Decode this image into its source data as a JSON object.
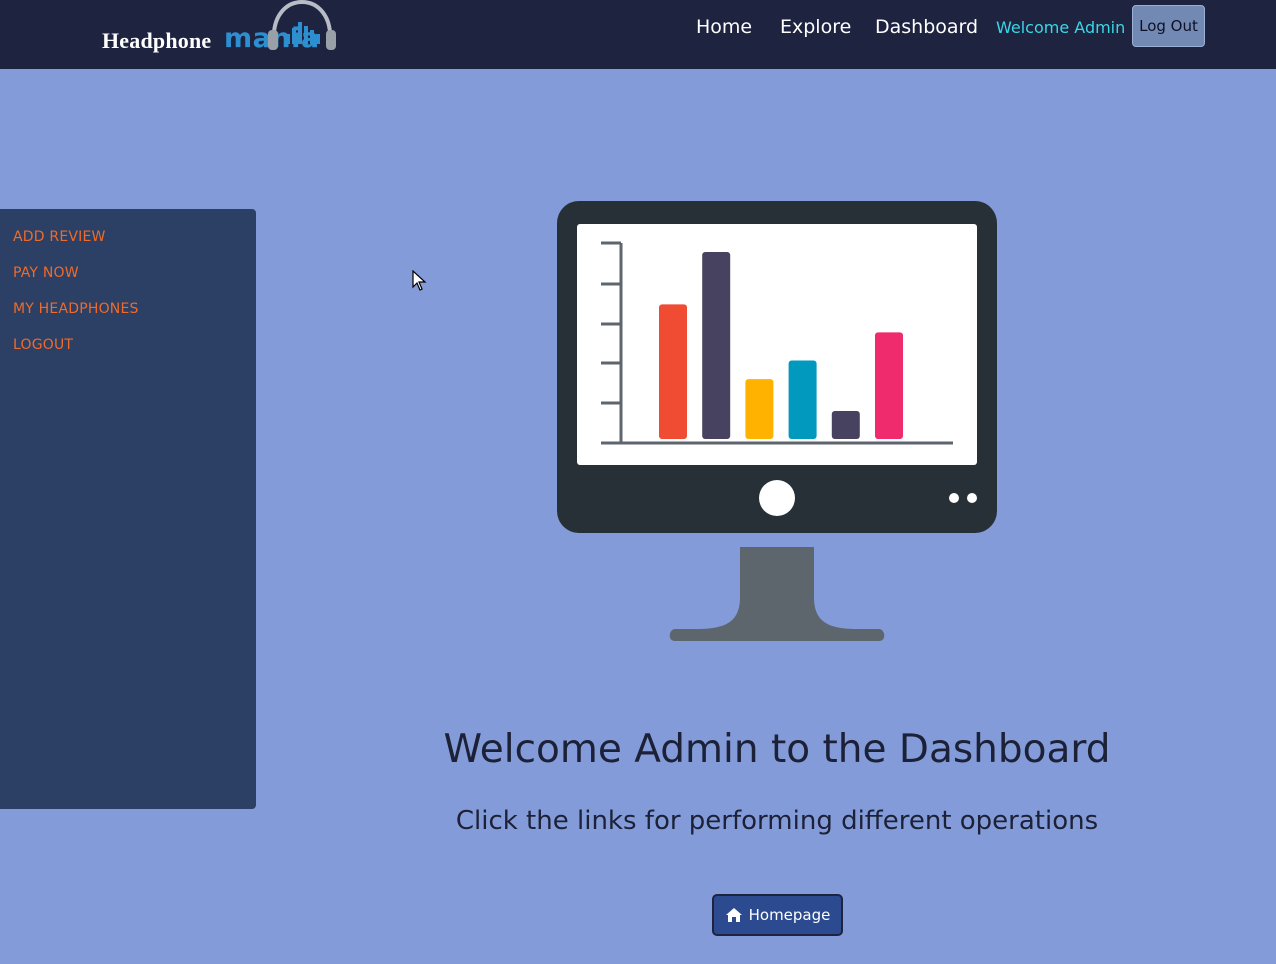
{
  "header": {
    "logo_part1": "Headphone",
    "logo_part2": "mania",
    "nav": [
      "Home",
      "Explore",
      "Dashboard"
    ],
    "welcome": "Welcome Admin",
    "logout_label": "Log Out"
  },
  "sidebar": {
    "items": [
      {
        "label": "ADD REVIEW"
      },
      {
        "label": "PAY NOW"
      },
      {
        "label": "MY HEADPHONES"
      },
      {
        "label": "LOGOUT"
      }
    ]
  },
  "main": {
    "title": "Welcome Admin to the Dashboard",
    "subtitle": "Click the links for performing different operations",
    "home_button_label": "Homepage",
    "home_button_icon": "home-icon"
  },
  "illustration": {
    "bar_levels": [
      0.72,
      1.0,
      0.32,
      0.42,
      0.15,
      0.57
    ],
    "bar_colors": [
      "#ef4c33",
      "#46425f",
      "#ffb200",
      "#0199bd",
      "#46425f",
      "#ef2a6d"
    ]
  },
  "colors": {
    "nav_bg": "#1e2340",
    "page_bg": "#839cd9",
    "sidebar_bg": "#2b4064",
    "sidebar_link": "#f06a2a",
    "welcome_text": "#3ad7e6",
    "button_bg": "#2b4a8f"
  }
}
